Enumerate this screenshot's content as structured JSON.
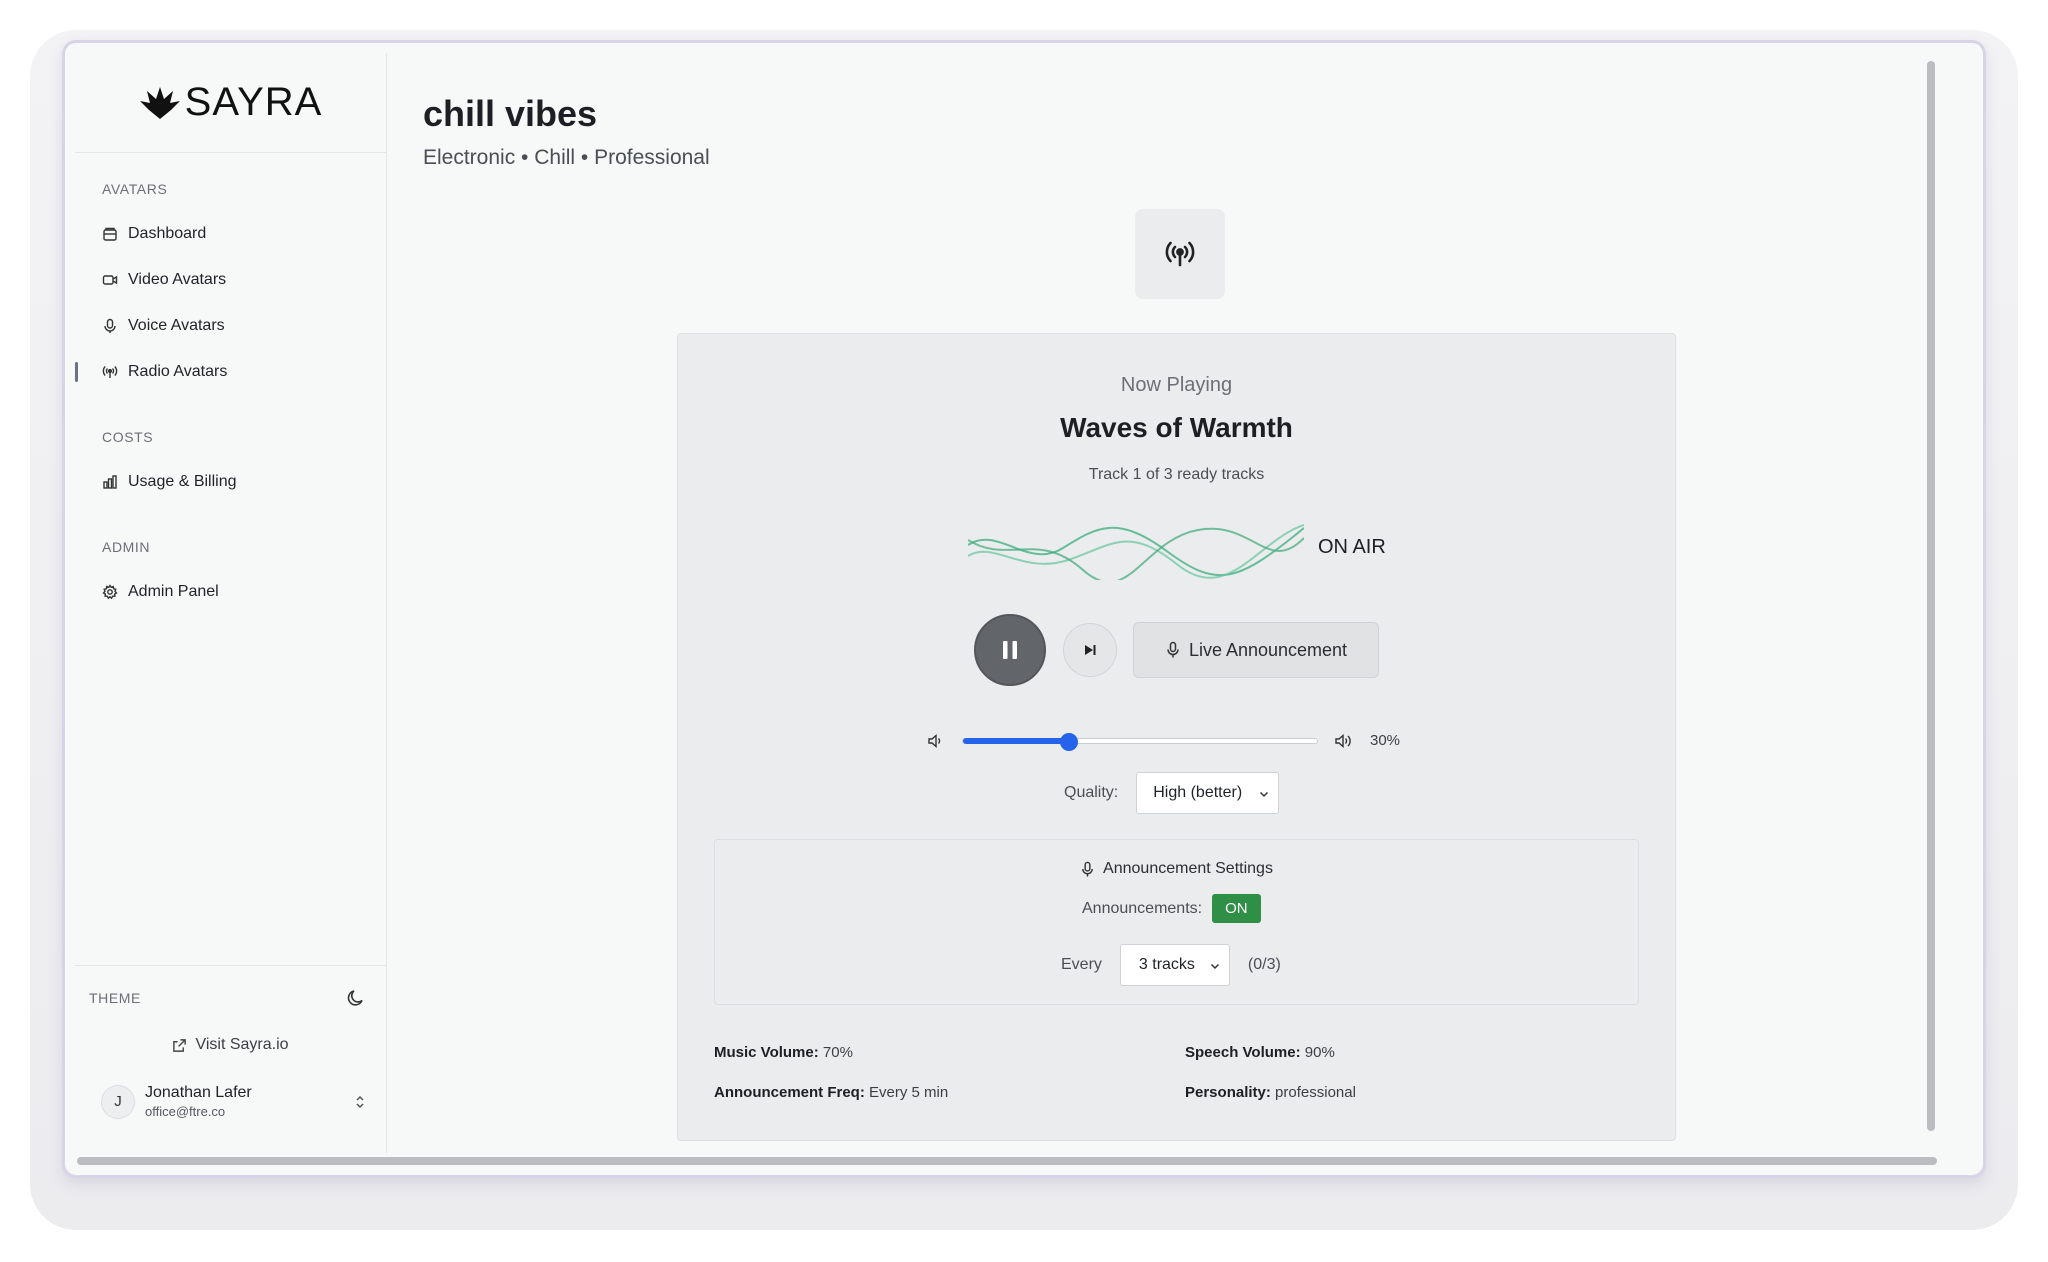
{
  "brand": {
    "name": "SAYRA"
  },
  "sidebar": {
    "sections": [
      {
        "label": "AVATARS",
        "items": [
          {
            "label": "Dashboard",
            "icon": "dashboard-icon"
          },
          {
            "label": "Video Avatars",
            "icon": "video-icon"
          },
          {
            "label": "Voice Avatars",
            "icon": "microphone-icon"
          },
          {
            "label": "Radio Avatars",
            "icon": "radio-icon",
            "active": true
          }
        ]
      },
      {
        "label": "COSTS",
        "items": [
          {
            "label": "Usage & Billing",
            "icon": "bar-chart-icon"
          }
        ]
      },
      {
        "label": "ADMIN",
        "items": [
          {
            "label": "Admin Panel",
            "icon": "gear-icon"
          }
        ]
      }
    ],
    "theme_label": "THEME",
    "visit_label": "Visit Sayra.io",
    "user": {
      "initial": "J",
      "name": "Jonathan Lafer",
      "email": "office@ftre.co"
    }
  },
  "page": {
    "title": "chill vibes",
    "subtitle": "Electronic • Chill • Professional"
  },
  "player": {
    "now_playing_label": "Now Playing",
    "track_title": "Waves of Warmth",
    "track_count": "Track 1 of 3 ready tracks",
    "on_air_label": "ON AIR",
    "live_announcement_label": "Live Announcement",
    "volume": 0.3,
    "volume_label": "30%",
    "quality_label": "Quality:",
    "quality_value": "High (better)",
    "accent_color": "#2563eb",
    "wave_color": "#4fb58a"
  },
  "announcements": {
    "header": "Announcement Settings",
    "toggle_label": "Announcements:",
    "toggle_value": "ON",
    "toggle_color": "#2f8f47",
    "every_label": "Every",
    "every_value": "3 tracks",
    "progress": "(0/3)"
  },
  "stats": {
    "music_volume_label": "Music Volume:",
    "music_volume_value": "70%",
    "speech_volume_label": "Speech Volume:",
    "speech_volume_value": "90%",
    "announcement_freq_label": "Announcement Freq:",
    "announcement_freq_value": "Every 5 min",
    "personality_label": "Personality:",
    "personality_value": "professional"
  }
}
